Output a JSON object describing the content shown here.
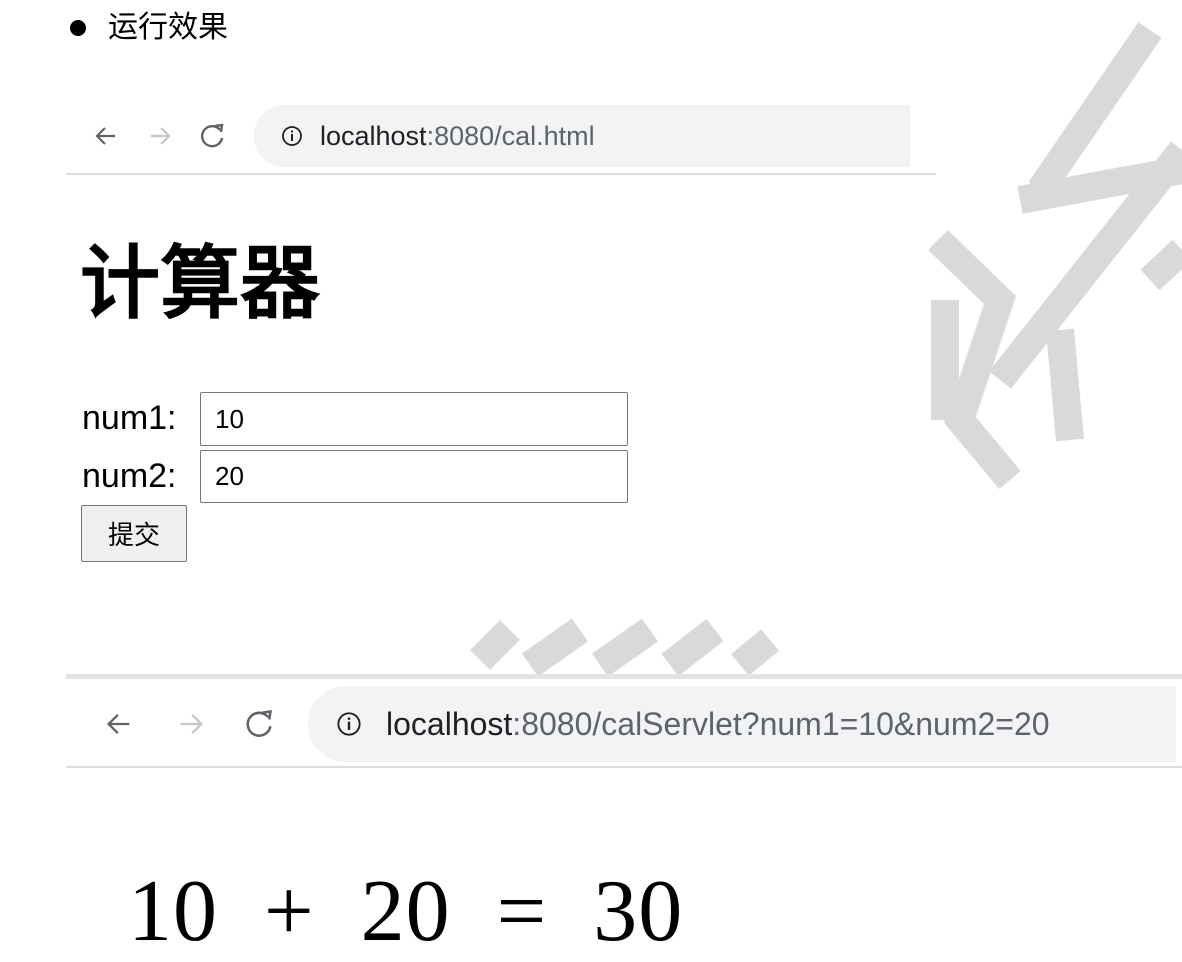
{
  "section_heading": "运行效果",
  "browser1": {
    "url_host": "localhost",
    "url_rest": ":8080/cal.html"
  },
  "page1": {
    "title": "计算器",
    "num1_label": "num1:",
    "num1_value": "10",
    "num2_label": "num2:",
    "num2_value": "20",
    "submit_label": "提交"
  },
  "browser2": {
    "url_host": "localhost",
    "url_rest": ":8080/calServlet?num1=10&num2=20"
  },
  "result": {
    "expression": "10  +  20  =  30"
  },
  "colors": {
    "address_bg": "#f1f3f4",
    "nav_enabled": "#5f6368",
    "nav_disabled": "#c4c7cc",
    "watermark": "#d9d9d9"
  },
  "icons": [
    "back-arrow-icon",
    "forward-arrow-icon",
    "reload-icon",
    "info-icon"
  ]
}
